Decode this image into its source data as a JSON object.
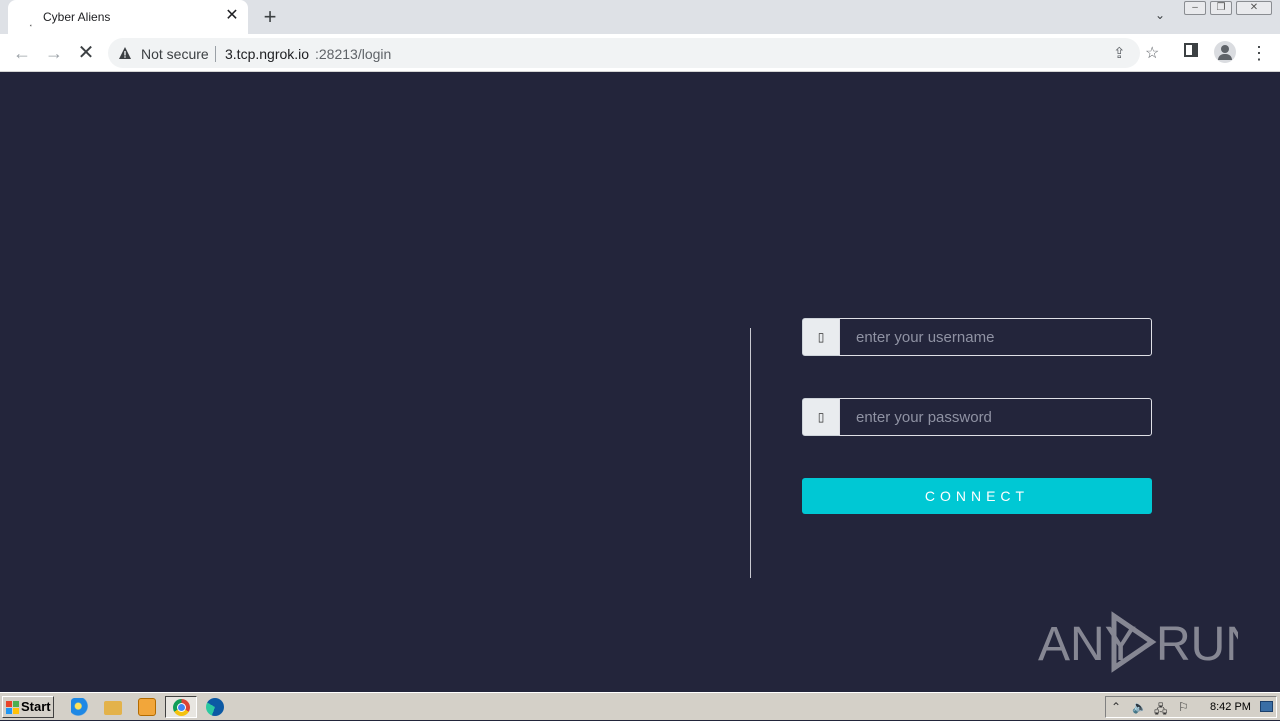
{
  "browser": {
    "tab": {
      "title": "Cyber Aliens",
      "close_glyph": "✕",
      "favicon_glyph": "⸼"
    },
    "new_tab_glyph": "+",
    "tab_search_glyph": "⌄",
    "window_controls": {
      "minimize": "–",
      "maximize": "❐",
      "close": "✕"
    },
    "toolbar": {
      "back_glyph": "←",
      "forward_glyph": "→",
      "stop_glyph": "✕",
      "security_label": "Not secure",
      "url_host": "3.tcp.ngrok.io",
      "url_rest": ":28213/login",
      "share_glyph": "⇪",
      "star_glyph": "☆",
      "menu_glyph": "⋮"
    }
  },
  "login": {
    "username_placeholder": "enter your username",
    "password_placeholder": "enter your password",
    "username_icon_glyph": "▯",
    "password_icon_glyph": "▯",
    "connect_label": "CONNECT"
  },
  "watermark": {
    "text": "ANY RUN"
  },
  "taskbar": {
    "start_label": "Start",
    "clock": "8:42 PM",
    "tray": {
      "up_glyph": "⌃",
      "volume_glyph": "🔈",
      "network_glyph": "🖧",
      "flag_glyph": "⚐"
    }
  },
  "colors": {
    "page_background": "#23253b",
    "accent": "#00c8d4",
    "input_border": "#dfe0e6",
    "placeholder": "#8f92a3"
  }
}
